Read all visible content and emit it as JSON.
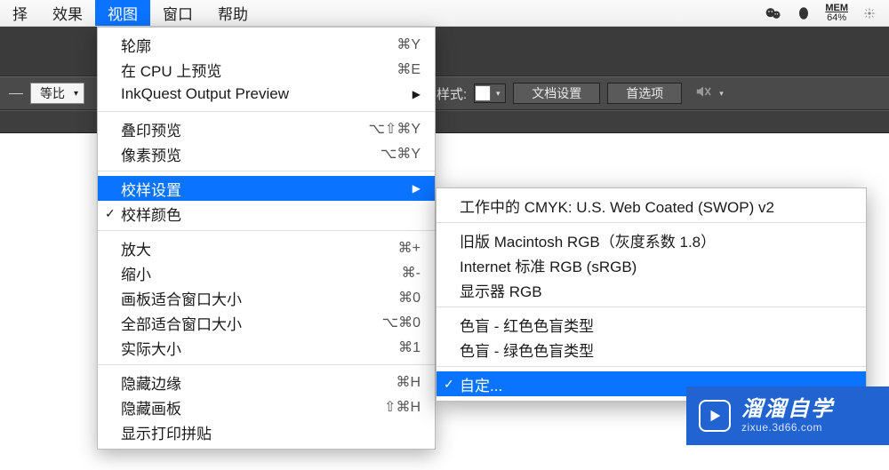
{
  "menubar": {
    "items": [
      "择",
      "效果",
      "视图",
      "窗口",
      "帮助"
    ],
    "active_index": 2,
    "mem_label": "MEM",
    "mem_pct": "64%"
  },
  "toolbar": {
    "dropdown_label": "等比",
    "style_label": "样式:",
    "doc_settings": "文档设置",
    "prefs": "首选项"
  },
  "menu": [
    {
      "label": "轮廓",
      "shortcut": "⌘Y"
    },
    {
      "label": "在 CPU 上预览",
      "shortcut": "⌘E"
    },
    {
      "label": "InkQuest Output Preview",
      "submenu": true
    },
    {
      "sep": true
    },
    {
      "label": "叠印预览",
      "shortcut": "⌥⇧⌘Y"
    },
    {
      "label": "像素预览",
      "shortcut": "⌥⌘Y"
    },
    {
      "sep": true
    },
    {
      "label": "校样设置",
      "submenu": true,
      "highlight": true
    },
    {
      "label": "校样颜色",
      "checked": true
    },
    {
      "sep": true
    },
    {
      "label": "放大",
      "shortcut": "⌘+"
    },
    {
      "label": "缩小",
      "shortcut": "⌘-"
    },
    {
      "label": "画板适合窗口大小",
      "shortcut": "⌘0"
    },
    {
      "label": "全部适合窗口大小",
      "shortcut": "⌥⌘0"
    },
    {
      "label": "实际大小",
      "shortcut": "⌘1"
    },
    {
      "sep": true
    },
    {
      "label": "隐藏边缘",
      "shortcut": "⌘H"
    },
    {
      "label": "隐藏画板",
      "shortcut": "⇧⌘H"
    },
    {
      "label": "显示打印拼贴"
    }
  ],
  "submenu": [
    {
      "label": "工作中的 CMYK: U.S. Web Coated (SWOP) v2"
    },
    {
      "sep": true
    },
    {
      "label": "旧版 Macintosh RGB（灰度系数 1.8）"
    },
    {
      "label": "Internet 标准 RGB (sRGB)"
    },
    {
      "label": "显示器 RGB"
    },
    {
      "sep": true
    },
    {
      "label": "色盲 - 红色色盲类型"
    },
    {
      "label": "色盲 - 绿色色盲类型"
    },
    {
      "sep": true
    },
    {
      "label": "自定...",
      "checked": true,
      "highlight": true
    }
  ],
  "badge": {
    "title": "溜溜自学",
    "url": "zixue.3d66.com"
  }
}
